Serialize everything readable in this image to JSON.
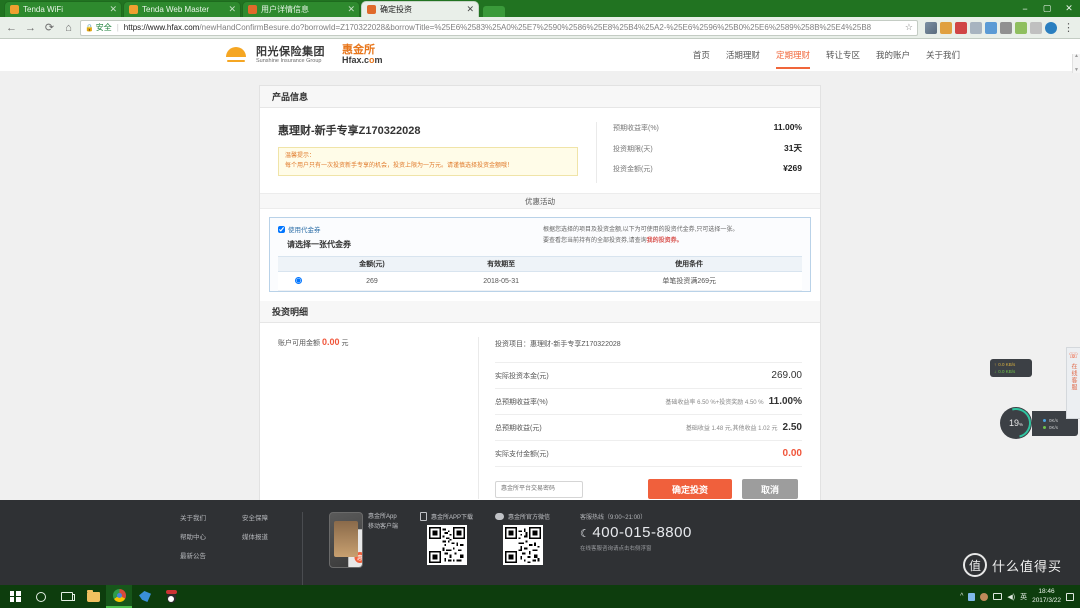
{
  "browser": {
    "tabs": [
      {
        "label": "Tenda WiFi",
        "active": false
      },
      {
        "label": "Tenda Web Master",
        "active": false
      },
      {
        "label": "用户详情信息",
        "active": false
      },
      {
        "label": "确定投资",
        "active": true
      }
    ],
    "close_glyph": "✕",
    "back_glyph": "←",
    "forward_glyph": "→",
    "reload_glyph": "⟳",
    "home_glyph": "⌂",
    "lock_glyph": "🔒",
    "secure_label": "安全",
    "url_domain": "https://www.hfax.com",
    "url_path": "/newHandConfirmBesure.do?borrowId=Z170322028&borrowTitle=%25E6%2583%25A0%25E7%2590%2586%25E8%25B4%25A2-%25E6%2596%25B0%25E6%2589%258B%25E4%25B8",
    "star_glyph": "☆",
    "kebab_glyph": "⋮",
    "window_minimize": "−",
    "window_maximize": "▢",
    "window_close": "✕"
  },
  "site": {
    "brand_cn": "阳光保险集团",
    "brand_en": "Sunshine Insurance Group",
    "hfax_cn": "惠金所",
    "hfax_en_pre": "Hfax.c",
    "hfax_en_o": "o",
    "hfax_en_post": "m",
    "nav": [
      {
        "label": "首页",
        "active": false
      },
      {
        "label": "活期理财",
        "active": false
      },
      {
        "label": "定期理财",
        "active": true
      },
      {
        "label": "转让专区",
        "active": false
      },
      {
        "label": "我的账户",
        "active": false
      },
      {
        "label": "关于我们",
        "active": false
      }
    ]
  },
  "product": {
    "section_title": "产品信息",
    "name": "惠理财-新手专享Z170322028",
    "tip_title": "温馨提示：",
    "tip_body": "每个用户只有一次投资新手专享的机会，投资上限为一万元。请谨慎选择投资金额哦！",
    "stats": [
      {
        "label": "预期收益率(%)",
        "value": "11.00%"
      },
      {
        "label": "投资期限(天)",
        "value": "31天"
      },
      {
        "label": "投资金额(元)",
        "value": "¥269"
      }
    ]
  },
  "promo": {
    "subhead": "优惠活动",
    "use_voucher_label": "使用代金券",
    "use_voucher_checked": true,
    "choose_label": "请选择一张代金券",
    "desc_line1": "根据您选择的项目及投资金额,以下为可使用的投资代金券,只可选择一张。",
    "desc_line2_pre": "要查看您当前持有的全部投资券,请查询",
    "desc_link": "我的投资券。",
    "table": {
      "headers": [
        "",
        "金额(元)",
        "有效期至",
        "使用条件"
      ],
      "rows": [
        {
          "selected": true,
          "amount": "269",
          "expiry": "2018-05-31",
          "condition": "单笔投资满269元"
        }
      ]
    },
    "scroll_up": "▲",
    "scroll_down": "▼"
  },
  "invest": {
    "section_title": "投资明细",
    "balance_label": "账户可用金额",
    "balance_value": "0.00",
    "balance_unit": "元",
    "project_label": "投资项目：惠理财-新手专享Z170322028",
    "rows": [
      {
        "label": "实际投资本金(元)",
        "sub": "",
        "value": "269.00",
        "red": false
      },
      {
        "label": "总预期收益率(%)",
        "sub": "基础收益率 6.50 %+投资奖励 4.50 %",
        "value": "11.00%",
        "red": false
      },
      {
        "label": "总预期收益(元)",
        "sub": "基础收益 1.48 元,其他收益 1.02 元",
        "value": "2.50",
        "red": false
      },
      {
        "label": "实际支付金额(元)",
        "sub": "",
        "value": "0.00",
        "red": true
      }
    ],
    "password_placeholder": "惠金所平台交易密码",
    "password_value": "",
    "confirm_label": "确定投资",
    "cancel_label": "取消"
  },
  "footer": {
    "links_col1": [
      "关于我们",
      "帮助中心",
      "最新公告"
    ],
    "links_col2": [
      "安全保障",
      "媒体报道"
    ],
    "app1_line1": "惠金所App",
    "app1_line2": "移动客户端",
    "app2_title": "惠金所APP下载",
    "app3_title": "惠金所官方微信",
    "service_hours": "客服热线（9:00~21:00）",
    "tel": "400-015-8800",
    "tel_icon": "☾",
    "service_note": "在线客服咨询请点击右侧浮窗"
  },
  "widgets": {
    "net_up": "0.0 KB/s",
    "net_down": "0.0 KB/s",
    "up_arrow": "↑",
    "down_arrow": "↓",
    "cpu_percent": "19",
    "cpu_unit": "%",
    "stat_up": "0K/s",
    "stat_down": "0K/s",
    "kefu_icon": "☏",
    "kefu_label": "在线客服"
  },
  "watermark": {
    "circle_char": "值",
    "text": "什么值得买"
  },
  "taskbar": {
    "items": [
      {
        "name": "start",
        "label": ""
      },
      {
        "name": "cortana",
        "label": ""
      },
      {
        "name": "task-view",
        "label": ""
      },
      {
        "name": "file-explorer",
        "label": ""
      },
      {
        "name": "chrome",
        "label": ""
      },
      {
        "name": "foxmail",
        "label": ""
      },
      {
        "name": "qq",
        "label": ""
      }
    ],
    "tray_chevron": "^",
    "tray_ime": "英",
    "tray_volume": "◀)",
    "clock_time": "18:46",
    "clock_date": "2017/3/22"
  }
}
